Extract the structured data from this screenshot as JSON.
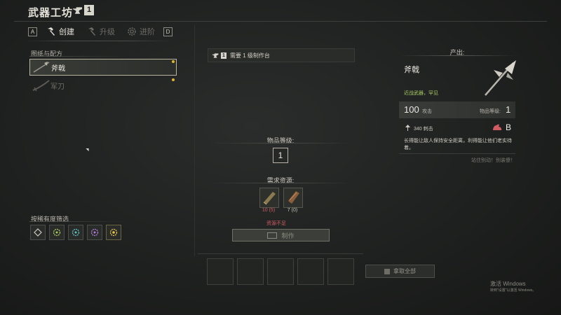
{
  "header": {
    "title": "武器工坊",
    "level_badge": "1"
  },
  "tabs": {
    "left_key": "A",
    "right_key": "D",
    "items": [
      {
        "label": "创建",
        "icon": "hammer-icon",
        "active": true
      },
      {
        "label": "升级",
        "icon": "hammer-icon",
        "active": false
      },
      {
        "label": "进阶",
        "icon": "gear-icon",
        "active": false
      }
    ]
  },
  "recipes": {
    "section_label": "图纸与配方",
    "items": [
      {
        "label": "斧戟",
        "selected": true
      },
      {
        "label": "军刀",
        "selected": false
      }
    ]
  },
  "rarity_filter": {
    "label": "按稀有度筛选",
    "colors": [
      "#cfcbc1",
      "#a8c964",
      "#5cc2c4",
      "#b07ad6",
      "#e5c44a"
    ]
  },
  "center": {
    "requirement_badge": "1",
    "requirement_text": "需要 1 级制作台",
    "item_level_label": "物品等级:",
    "item_level_value": "1",
    "resources_label": "需求资源:",
    "resources": [
      {
        "have": "10",
        "need": "(5)"
      },
      {
        "have": "7",
        "need": "(0)"
      }
    ],
    "insufficient": "资源不足",
    "craft_button": "制作",
    "take_all_button": "拿取全部"
  },
  "output": {
    "label": "产出:",
    "name": "斧戟",
    "type": "近战武器，罕见",
    "attack_value": "100",
    "attack_label": "攻击",
    "item_level_label": "物品等级:",
    "item_level_value": "1",
    "pierce": "340 刺击",
    "grade": "B",
    "description": "长得能让敌人保持安全距离，利得能让他们老实待着。",
    "quote": "站住别动！别装傻！"
  },
  "watermark": {
    "line1": "激活 Windows",
    "line2": "转到\"设置\"以激活 Windows。"
  }
}
